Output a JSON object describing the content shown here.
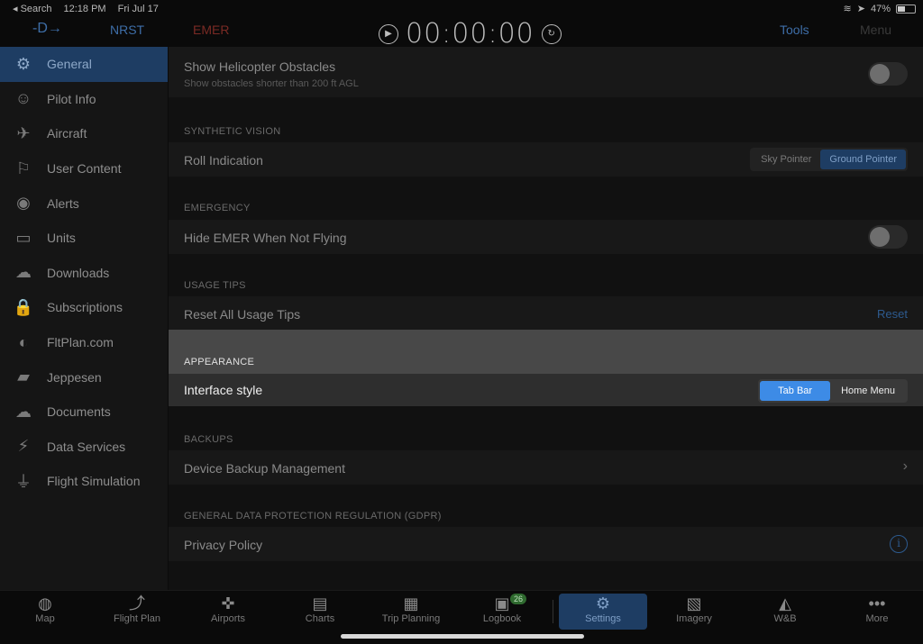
{
  "status": {
    "back": "◂ Search",
    "time": "12:18 PM",
    "date": "Fri Jul 17",
    "battery": "47%",
    "battery_level": 0.47
  },
  "toolbar": {
    "direct": "-D→",
    "nrst": "NRST",
    "emer": "EMER",
    "timer": "00:00:00",
    "tools": "Tools",
    "menu": "Menu"
  },
  "sidebar": {
    "items": [
      {
        "label": "General",
        "icon": "gear-icon",
        "glyph": "⚙"
      },
      {
        "label": "Pilot Info",
        "icon": "pilot-icon",
        "glyph": "☺"
      },
      {
        "label": "Aircraft",
        "icon": "airplane-icon",
        "glyph": "✈"
      },
      {
        "label": "User Content",
        "icon": "flag-icon",
        "glyph": "⚐"
      },
      {
        "label": "Alerts",
        "icon": "alert-icon",
        "glyph": "◉"
      },
      {
        "label": "Units",
        "icon": "ruler-icon",
        "glyph": "▭"
      },
      {
        "label": "Downloads",
        "icon": "cloud-download-icon",
        "glyph": "☁"
      },
      {
        "label": "Subscriptions",
        "icon": "lock-icon",
        "glyph": "🔒"
      },
      {
        "label": "FltPlan.com",
        "icon": "fltplan-icon",
        "glyph": "◐"
      },
      {
        "label": "Jeppesen",
        "icon": "jeppesen-icon",
        "glyph": "▰"
      },
      {
        "label": "Documents",
        "icon": "cloud-documents-icon",
        "glyph": "☁"
      },
      {
        "label": "Data Services",
        "icon": "data-services-icon",
        "glyph": "⚡"
      },
      {
        "label": "Flight Simulation",
        "icon": "joystick-icon",
        "glyph": "⏚"
      }
    ]
  },
  "main": {
    "heli": {
      "label": "Show Helicopter Obstacles",
      "sub": "Show obstacles shorter than 200 ft AGL"
    },
    "synthetic": {
      "section": "SYNTHETIC VISION",
      "label": "Roll Indication",
      "opt1": "Sky Pointer",
      "opt2": "Ground Pointer"
    },
    "emergency": {
      "section": "EMERGENCY",
      "label": "Hide EMER When Not Flying"
    },
    "usage": {
      "section": "USAGE TIPS",
      "label": "Reset All Usage Tips",
      "action": "Reset"
    },
    "appearance": {
      "section": "APPEARANCE",
      "label": "Interface style",
      "opt1": "Tab Bar",
      "opt2": "Home Menu"
    },
    "backups": {
      "section": "BACKUPS",
      "label": "Device Backup Management"
    },
    "gdpr": {
      "section": "GENERAL DATA PROTECTION REGULATION (GDPR)",
      "label": "Privacy Policy"
    }
  },
  "tabs": [
    {
      "label": "Map",
      "icon": "globe-icon",
      "glyph": "◍"
    },
    {
      "label": "Flight Plan",
      "icon": "flight-plan-icon",
      "glyph": "⤴"
    },
    {
      "label": "Airports",
      "icon": "airport-icon",
      "glyph": "✜"
    },
    {
      "label": "Charts",
      "icon": "charts-icon",
      "glyph": "▤"
    },
    {
      "label": "Trip Planning",
      "icon": "trip-planning-icon",
      "glyph": "▦"
    },
    {
      "label": "Logbook",
      "icon": "logbook-icon",
      "glyph": "▣",
      "badge": "26"
    },
    {
      "label": "Settings",
      "icon": "settings-icon",
      "glyph": "⚙"
    },
    {
      "label": "Imagery",
      "icon": "imagery-icon",
      "glyph": "▧"
    },
    {
      "label": "W&B",
      "icon": "weight-balance-icon",
      "glyph": "◭"
    },
    {
      "label": "More",
      "icon": "more-icon",
      "glyph": "•••"
    }
  ]
}
